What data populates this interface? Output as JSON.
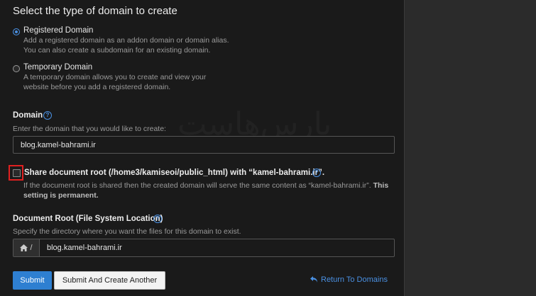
{
  "form": {
    "title": "Select the type of domain to create",
    "options": [
      {
        "label": "Registered Domain",
        "desc1": "Add a registered domain as an addon domain or domain alias.",
        "desc2": "You can also create a subdomain for an existing domain.",
        "selected": true
      },
      {
        "label": "Temporary Domain",
        "desc1": "A temporary domain allows you to create and view your",
        "desc2": "website before you add a registered domain.",
        "selected": false
      }
    ],
    "domain": {
      "label": "Domain",
      "hint": "Enter the domain that you would like to create:",
      "value": "blog.kamel-bahrami.ir"
    },
    "share": {
      "label": "Share document root (/home3/kamiseoi/public_html) with “kamel-bahrami.ir”.",
      "desc_line1": "If the document root is shared then the created domain will serve the same content as “kamel-bahrami.ir”.",
      "desc_bold": "This",
      "desc_line2_bold": "setting is permanent.",
      "checked": false
    },
    "docroot": {
      "label": "Document Root (File System Location)",
      "hint": "Specify the directory where you want the files for this domain to exist.",
      "prefix": "/",
      "value": "blog.kamel-bahrami.ir"
    },
    "buttons": {
      "submit": "Submit",
      "submit_another": "Submit And Create Another",
      "return_link": "Return To Domains"
    },
    "help_glyph": "?",
    "watermark": "پارس‌هاست"
  },
  "colors": {
    "accent": "#2e7fd1",
    "link": "#4a90e2",
    "highlight": "#e02020"
  }
}
